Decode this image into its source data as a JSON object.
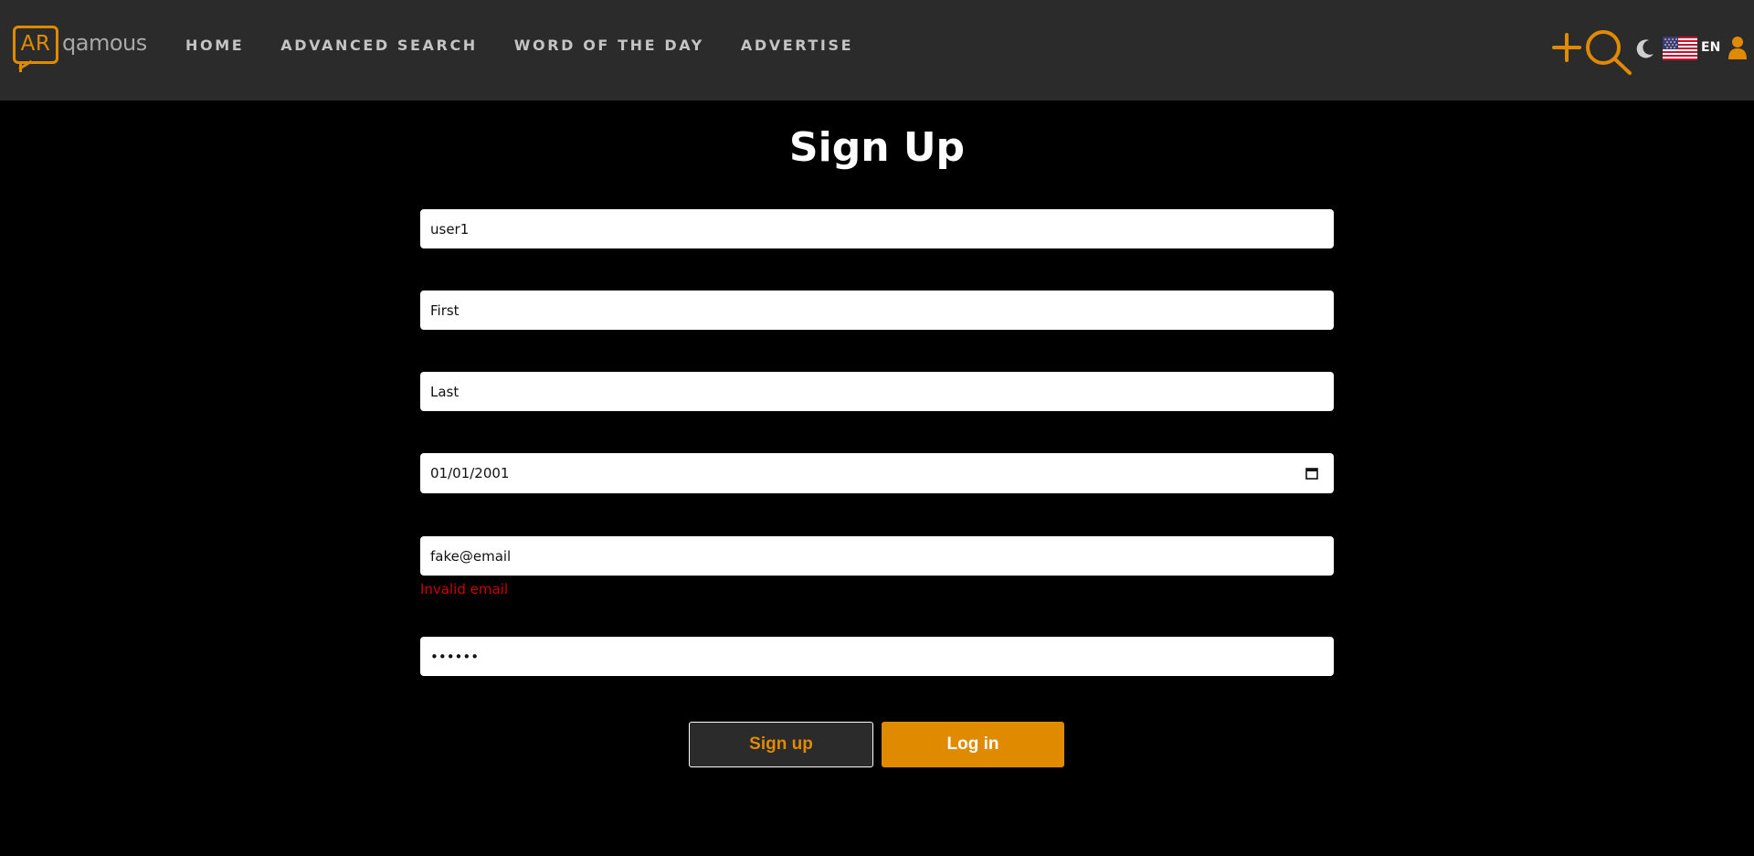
{
  "brand": {
    "logo_box_text": "AR",
    "logo_text": "qamous",
    "accent_color": "#e08a00"
  },
  "nav": {
    "items": [
      {
        "label": "HOME"
      },
      {
        "label": "ADVANCED SEARCH"
      },
      {
        "label": "WORD OF THE DAY"
      },
      {
        "label": "ADVERTISE"
      }
    ]
  },
  "tools": {
    "icons": [
      "plus-icon",
      "search-icon",
      "moon-icon",
      "us-flag-icon",
      "user-icon"
    ],
    "language": "EN"
  },
  "form": {
    "title": "Sign Up",
    "username_value": "user1",
    "first_name_value": "First",
    "last_name_value": "Last",
    "birthdate_value": "01/01/2001",
    "email_value": "fake@email",
    "email_error": "Invalid email",
    "password_value": "••••••",
    "signup_label": "Sign up",
    "login_label": "Log in",
    "error_color": "#cc0000"
  }
}
